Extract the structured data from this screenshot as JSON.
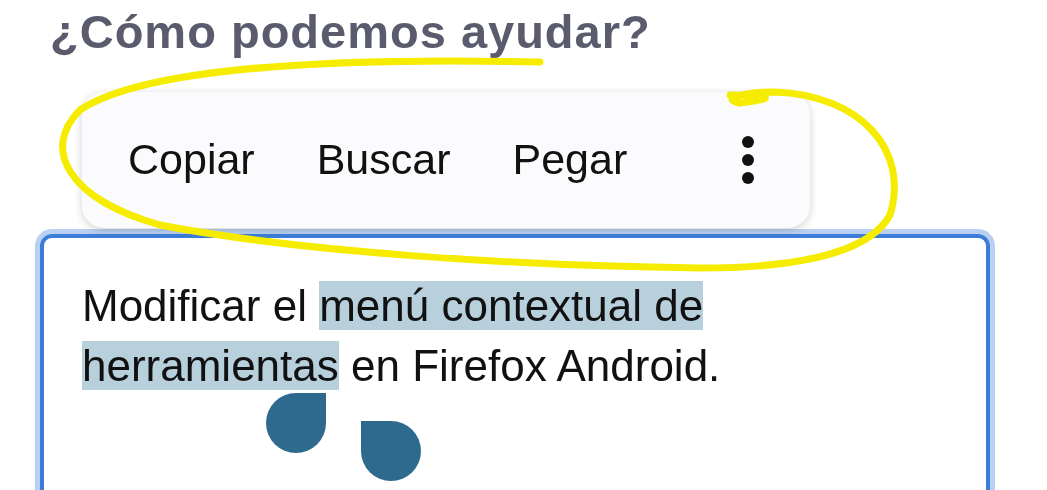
{
  "heading": "¿Cómo podemos ayudar?",
  "context_menu": {
    "items": [
      {
        "label": "Copiar"
      },
      {
        "label": "Buscar"
      },
      {
        "label": "Pegar"
      }
    ],
    "more": true
  },
  "editor": {
    "text_before": "Modificar el ",
    "selected_text": "menú contextual de herramientas",
    "text_after": " en Firefox Android."
  }
}
